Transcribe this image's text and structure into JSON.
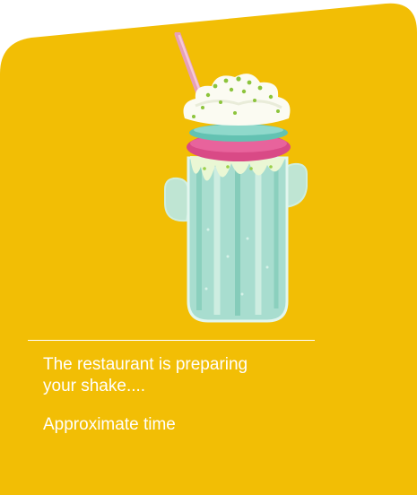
{
  "card": {
    "background_color": "#F2BE05"
  },
  "image": {
    "subject_icon": "cactus-milkshake-illustration"
  },
  "status": {
    "line1": "The restaurant is preparing",
    "line2": "your shake...."
  },
  "time": {
    "label": "Approximate time"
  }
}
